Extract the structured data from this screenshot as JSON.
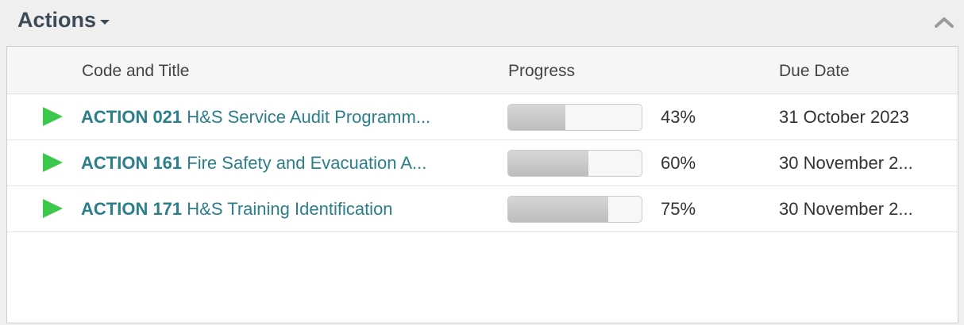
{
  "panel": {
    "title": "Actions",
    "collapse_icon": "chevron-up-icon"
  },
  "table": {
    "headers": {
      "code_title": "Code and Title",
      "progress": "Progress",
      "due_date": "Due Date"
    },
    "rows": [
      {
        "code": "ACTION 021",
        "title": "H&S Service Audit Programm...",
        "progress": 0.43,
        "progress_label": "43%",
        "due_date": "31 October 2023",
        "icon": "play-icon"
      },
      {
        "code": "ACTION 161",
        "title": "Fire Safety and Evacuation A...",
        "progress": 0.6,
        "progress_label": "60%",
        "due_date": "30 November 2...",
        "icon": "play-icon"
      },
      {
        "code": "ACTION 171",
        "title": "H&S Training Identification",
        "progress": 0.75,
        "progress_label": "75%",
        "due_date": "30 November 2...",
        "icon": "play-icon"
      }
    ]
  },
  "colors": {
    "status_green": "#3cc84a",
    "link_teal": "#2a7f8a",
    "title_dark": "#3c4b57"
  }
}
